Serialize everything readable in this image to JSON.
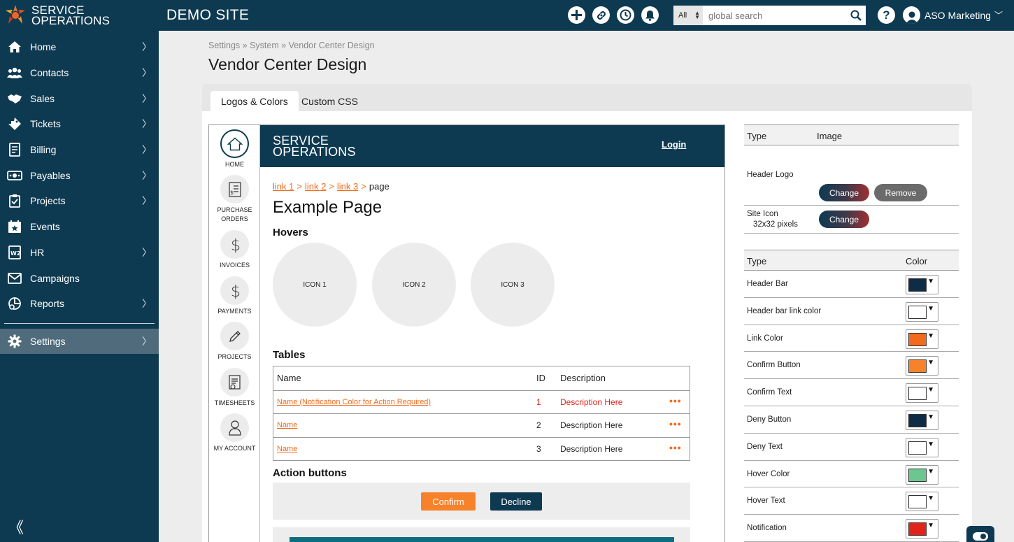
{
  "brand": {
    "line1": "SERVICE",
    "line2": "OPERATIONS"
  },
  "topbar": {
    "site_title": "DEMO SITE",
    "search_scope": "All",
    "search_placeholder": "global search",
    "help": "?",
    "user_name": "ASO Marketing",
    "user_caret": "﹀"
  },
  "sidebar": {
    "items": [
      {
        "label": "Home"
      },
      {
        "label": "Contacts"
      },
      {
        "label": "Sales"
      },
      {
        "label": "Tickets"
      },
      {
        "label": "Billing"
      },
      {
        "label": "Payables"
      },
      {
        "label": "Projects"
      },
      {
        "label": "Events"
      },
      {
        "label": "HR"
      },
      {
        "label": "Campaigns"
      },
      {
        "label": "Reports"
      }
    ],
    "settings_label": "Settings",
    "chevron": "〉",
    "collapse": "《"
  },
  "breadcrumb": {
    "text": "Settings  »  System  »  Vendor Center Design"
  },
  "page_title": "Vendor Center Design",
  "tabs": [
    {
      "label": "Logos & Colors"
    },
    {
      "label": "Custom CSS"
    }
  ],
  "preview": {
    "side_items": {
      "home": "HOME",
      "po_line1": "PURCHASE",
      "po_line2": "ORDERS",
      "invoices": "INVOICES",
      "payments": "PAYMENTS",
      "projects": "PROJECTS",
      "timesheets": "TIMESHEETS",
      "account": "MY ACCOUNT"
    },
    "logo_line1": "SERVICE",
    "logo_line2": "OPERATIONS",
    "login": "Login",
    "crumbs": {
      "link1": "link 1",
      "link2": "link 2",
      "link3": "link 3",
      "sep": ">",
      "page": "page"
    },
    "title": "Example Page",
    "hovers_heading": "Hovers",
    "hover_icons": [
      "ICON 1",
      "ICON 2",
      "ICON 3"
    ],
    "tables_heading": "Tables",
    "table": {
      "headers": {
        "name": "Name",
        "id": "ID",
        "desc": "Description"
      },
      "rows": [
        {
          "name": "Name (Notification Color for Action Required)",
          "id": "1",
          "desc": "Description Here",
          "dots": "•••"
        },
        {
          "name": "Name",
          "id": "2",
          "desc": "Description Here",
          "dots": "•••"
        },
        {
          "name": "Name",
          "id": "3",
          "desc": "Description Here",
          "dots": "•••"
        }
      ]
    },
    "actions_heading": "Action buttons",
    "confirm": "Confirm",
    "decline": "Decline"
  },
  "images_panel": {
    "col_type": "Type",
    "col_image": "Image",
    "header_logo": "Header Logo",
    "change": "Change",
    "remove": "Remove",
    "site_icon": "Site Icon",
    "site_icon_size": "32x32 pixels"
  },
  "colors_panel": {
    "col_type": "Type",
    "col_color": "Color",
    "arrow": "▼",
    "rows": [
      {
        "label": "Header Bar",
        "color": "#0e2c45"
      },
      {
        "label": "Header bar link color",
        "color": "#ffffff"
      },
      {
        "label": "Link Color",
        "color": "#f26b1d"
      },
      {
        "label": "Confirm Button",
        "color": "#f7822c"
      },
      {
        "label": "Confirm Text",
        "color": "#ffffff"
      },
      {
        "label": "Deny Button",
        "color": "#0e2c45"
      },
      {
        "label": "Deny Text",
        "color": "#ffffff"
      },
      {
        "label": "Hover Color",
        "color": "#6cc690"
      },
      {
        "label": "Hover Text",
        "color": "#ffffff"
      },
      {
        "label": "Notification",
        "color": "#e2231a"
      }
    ]
  }
}
